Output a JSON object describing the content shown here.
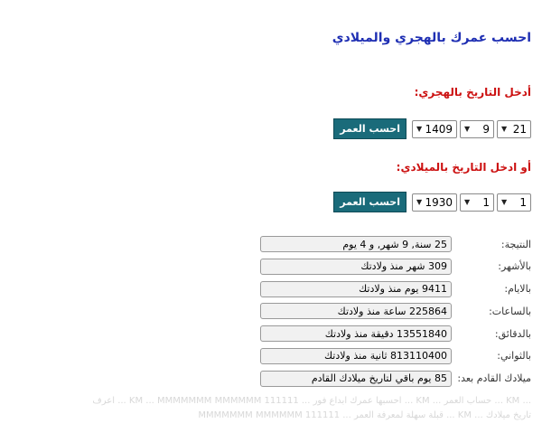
{
  "page": {
    "title": "احسب عمرك بالهجري والميلادي"
  },
  "hijri": {
    "label": "أدخل التاريخ بالهجري:",
    "day": "21",
    "month": "9",
    "year": "1409",
    "button": "احسب العمر"
  },
  "gregorian": {
    "label": "أو ادخل التاريخ بالميلادي:",
    "day": "1",
    "month": "1",
    "year": "1930",
    "button": "احسب العمر"
  },
  "results": [
    {
      "label": "النتيجة:",
      "value": "25 سنة, 9 شهر, و 4 يوم"
    },
    {
      "label": "بالأشهر:",
      "value": "309 شهر منذ ولادتك"
    },
    {
      "label": "بالايام:",
      "value": "9411 يوم منذ ولادتك"
    },
    {
      "label": "بالساعات:",
      "value": "225864 ساعة منذ ولادتك"
    },
    {
      "label": "بالدقائق:",
      "value": "13551840 دقيقة منذ ولادتك"
    },
    {
      "label": "بالثواني:",
      "value": "813110400 ثانية منذ ولادتك"
    },
    {
      "label": "ميلادك القادم بعد:",
      "value": "85 يوم باقي لتاريخ ميلادك القادم"
    }
  ],
  "footer": {
    "line1": "... KM ... حساب العمر ... KM ... احسبها عمرك ابداع فور ... KM ... MMMMMMM MMMMMM 111111 ... اعرف",
    "line2": "تاريخ ميلادك ... KM ... قبلة سهلة لمعرفة العمر ... MMMMMMM MMMMMM 111111"
  }
}
